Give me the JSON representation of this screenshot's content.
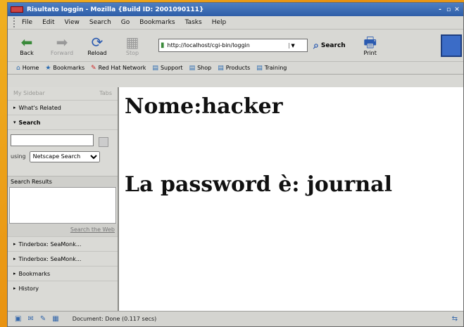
{
  "window": {
    "title": "Risultato loggin - Mozilla {Build ID: 2001090111}",
    "controls": [
      "-",
      "▫",
      "✕"
    ]
  },
  "menu": [
    "File",
    "Edit",
    "View",
    "Search",
    "Go",
    "Bookmarks",
    "Tasks",
    "Help"
  ],
  "nav": {
    "back": "Back",
    "forward": "Forward",
    "reload": "Reload",
    "stop": "Stop",
    "url": "http://localhost/cgi-bin/loggin",
    "search": "Search",
    "print": "Print"
  },
  "personal_toolbar": [
    "Home",
    "Bookmarks",
    "Red Hat Network",
    "Support",
    "Shop",
    "Products",
    "Training"
  ],
  "sidebar": {
    "header_title": "My Sidebar",
    "header_tabs": "Tabs",
    "whats_related": "What's Related",
    "search": "Search",
    "using_label": "using",
    "engine": "Netscape Search",
    "results_label": "Search Results",
    "search_web": "Search the Web",
    "bottom_items": [
      "Tinderbox: SeaMonk...",
      "Tinderbox: SeaMonk...",
      "Bookmarks",
      "History"
    ]
  },
  "page": {
    "line1": "Nome:hacker",
    "line2": "La password è: journal"
  },
  "status": {
    "message": "Document: Done (0.117 secs)"
  },
  "colors": {
    "titlebar": "#2f5ea8",
    "background": "#e89010"
  }
}
